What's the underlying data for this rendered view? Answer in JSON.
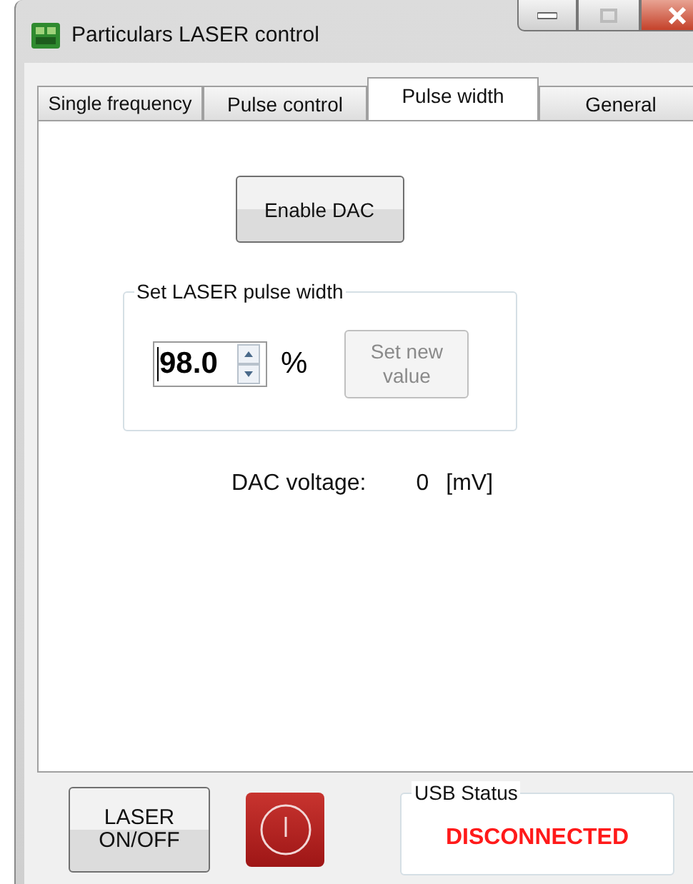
{
  "window": {
    "title": "Particulars LASER control"
  },
  "tabs": [
    {
      "label": "Single frequency",
      "selected": false
    },
    {
      "label": "Pulse control",
      "selected": false
    },
    {
      "label": "Pulse width",
      "selected": true
    },
    {
      "label": "General",
      "selected": false
    }
  ],
  "enable_dac_button": {
    "label": "Enable DAC"
  },
  "pulse_width_group": {
    "title": "Set LASER pulse width",
    "value": "98.0",
    "unit": "%",
    "set_button": {
      "label": "Set new value",
      "disabled": true
    }
  },
  "dac_voltage": {
    "label": "DAC voltage:",
    "value": "0",
    "unit": "[mV]"
  },
  "laser_button": {
    "label": "LASER ON/OFF"
  },
  "laser_indicator": {
    "on": false
  },
  "usb_status": {
    "title": "USB Status",
    "status": "DISCONNECTED",
    "connected": false
  }
}
